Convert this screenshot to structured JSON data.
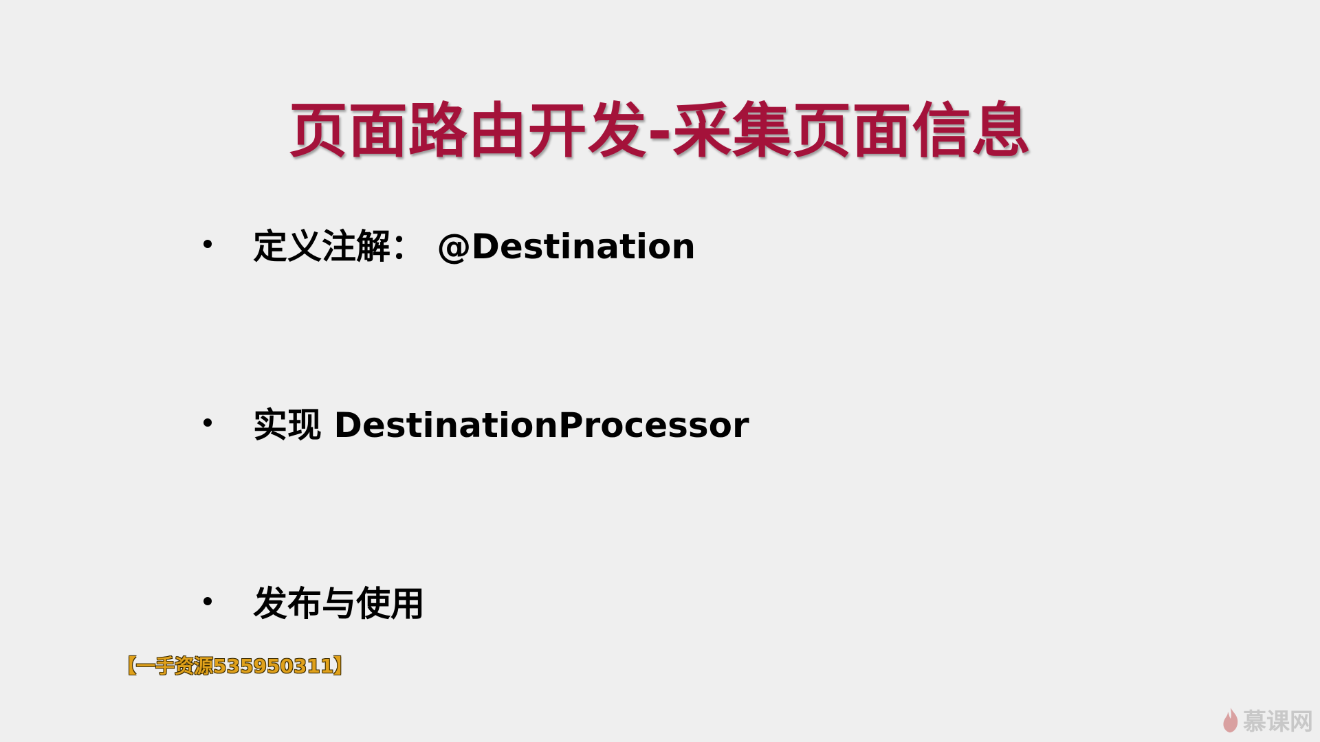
{
  "slide": {
    "title": "页面路由开发-采集页面信息",
    "bullets": [
      {
        "text": "定义注解： @Destination"
      },
      {
        "text": "实现 DestinationProcessor"
      },
      {
        "text": "发布与使用"
      }
    ],
    "watermark": "【一手资源535950311】",
    "logo": {
      "text": "慕课网",
      "icon": "flame-icon"
    }
  },
  "colors": {
    "background": "#efefef",
    "title": "#a4123a",
    "text": "#000000",
    "watermark": "#e0a11b",
    "logo": "#c8c8c8"
  }
}
